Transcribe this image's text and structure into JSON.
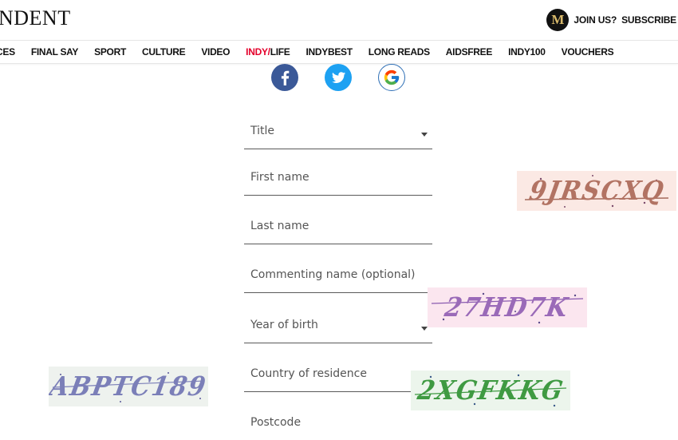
{
  "header": {
    "logo_text": "NDENT",
    "member_badge": "M",
    "join_label": "JOIN US?",
    "subscribe_label": "SUBSCRIBE"
  },
  "nav": {
    "items": [
      {
        "label": "ICES"
      },
      {
        "label": "FINAL SAY"
      },
      {
        "label": "SPORT"
      },
      {
        "label": "CULTURE"
      },
      {
        "label": "VIDEO"
      },
      {
        "label_red": "INDY/",
        "label": "LIFE"
      },
      {
        "label": "INDYBEST"
      },
      {
        "label": "LONG READS"
      },
      {
        "label": "AIDSFREE"
      },
      {
        "label": "INDY100"
      },
      {
        "label": "VOUCHERS"
      }
    ]
  },
  "social": {
    "icons": [
      "facebook-icon",
      "twitter-icon",
      "google-icon"
    ],
    "colors": {
      "facebook": "#3b5998",
      "twitter": "#1da1f2"
    }
  },
  "form": {
    "title": "Title",
    "first_name": "First name",
    "last_name": "Last name",
    "commenting_name": "Commenting name (optional)",
    "year_of_birth": "Year of birth",
    "country": "Country of residence",
    "postcode": "Postcode"
  },
  "captchas": [
    {
      "text": "9JRSCXQ",
      "bg": "#fbe9e4",
      "color": "#b27363"
    },
    {
      "text": "27HD7K",
      "bg": "#fbe6ef",
      "color": "#9a6ab8"
    },
    {
      "text": "ABPTC189",
      "bg": "#eef2ee",
      "color": "#7b7fb8"
    },
    {
      "text": "2XGFKKG",
      "bg": "#ecf5ec",
      "color": "#3f9a42"
    }
  ]
}
